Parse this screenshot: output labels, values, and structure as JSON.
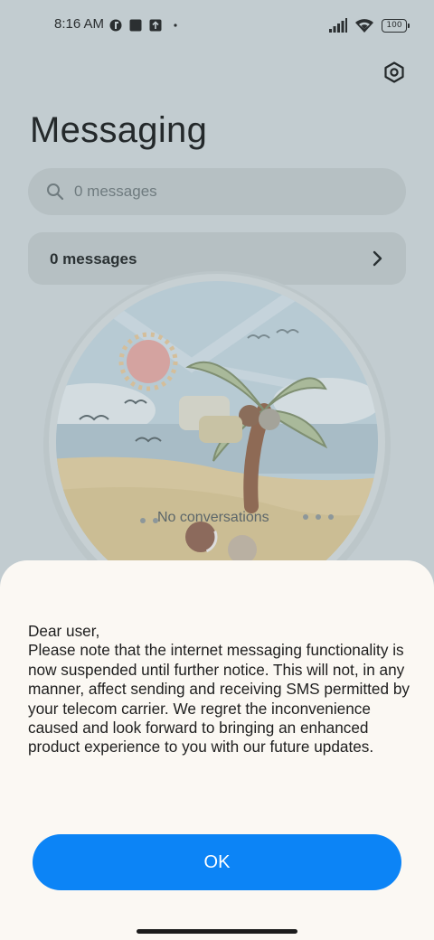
{
  "status_bar": {
    "time": "8:16 AM",
    "left_icons": [
      "vpn-key-icon",
      "square-notification-icon",
      "upload-notification-icon",
      "dot-icon"
    ],
    "right_icons": [
      "signal-icon",
      "wifi-icon"
    ],
    "battery": "100"
  },
  "header": {
    "title": "Messaging",
    "settings_icon": "gear-icon"
  },
  "search": {
    "placeholder": "0 messages"
  },
  "messages_row": {
    "label": "0 messages"
  },
  "empty_state": {
    "label": "No conversations"
  },
  "dialog": {
    "message": "Dear user,\nPlease note that the internet messaging functionality is now suspended until further notice. This will not, in any manner, affect sending and receiving SMS permitted by your telecom carrier. We regret the inconvenience caused and look forward to bringing an enhanced product experience to you with our future updates.",
    "ok_label": "OK"
  },
  "colors": {
    "accent": "#0c84f6",
    "overlay_background": "#c2ccd0",
    "dialog_background": "#fbf8f3"
  }
}
